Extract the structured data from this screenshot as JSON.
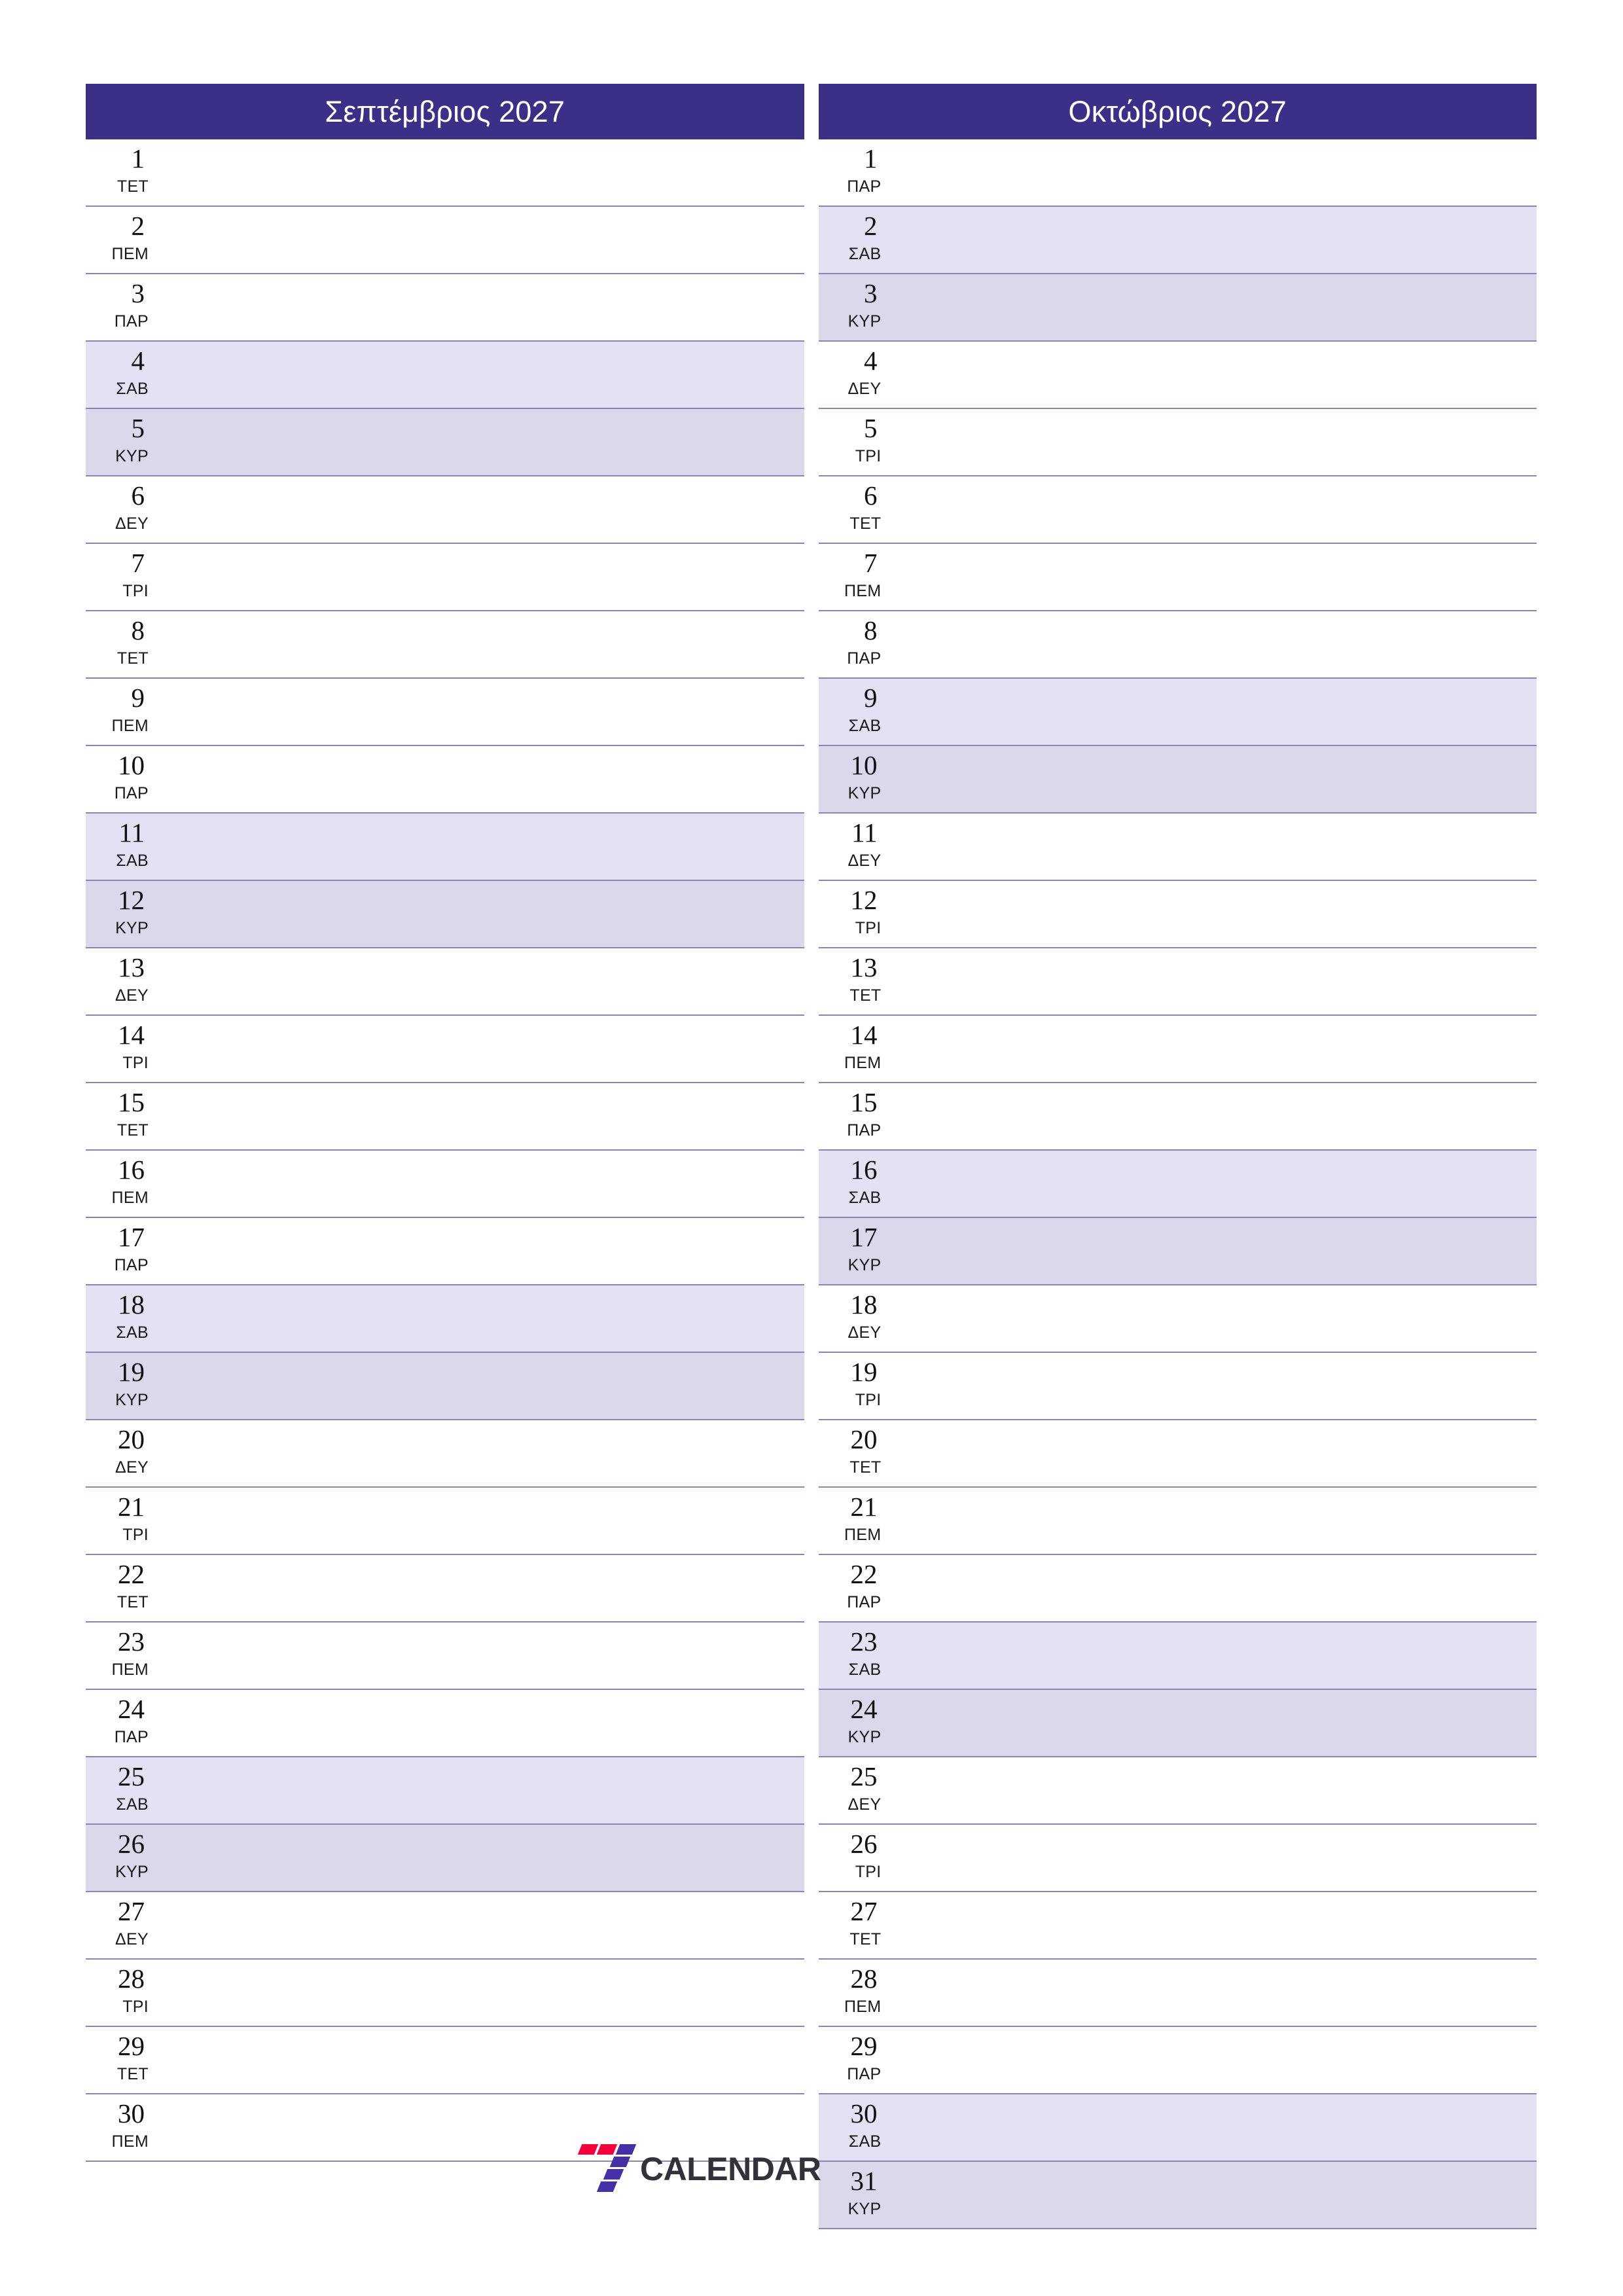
{
  "document": {
    "type": "two-month-planner",
    "orientation": "portrait",
    "colors": {
      "header_bg": "#3A3088",
      "header_text": "#FFFFFF",
      "saturday_bg": "#E2E2F4",
      "sunday_bg": "#DCD8EC",
      "row_divider": "#8A86B4",
      "logo_red": "#F4003C",
      "logo_purple": "#4530A8",
      "logo_word": "#32323A"
    }
  },
  "months": [
    {
      "title": "Σεπτέμβριος 2027",
      "days": [
        {
          "num": "1",
          "dow": "ΤΕΤ",
          "kind": "weekday"
        },
        {
          "num": "2",
          "dow": "ΠΕΜ",
          "kind": "weekday"
        },
        {
          "num": "3",
          "dow": "ΠΑΡ",
          "kind": "weekday"
        },
        {
          "num": "4",
          "dow": "ΣΑΒ",
          "kind": "sat"
        },
        {
          "num": "5",
          "dow": "ΚΥΡ",
          "kind": "sun"
        },
        {
          "num": "6",
          "dow": "ΔΕΥ",
          "kind": "weekday"
        },
        {
          "num": "7",
          "dow": "ΤΡΙ",
          "kind": "weekday"
        },
        {
          "num": "8",
          "dow": "ΤΕΤ",
          "kind": "weekday"
        },
        {
          "num": "9",
          "dow": "ΠΕΜ",
          "kind": "weekday"
        },
        {
          "num": "10",
          "dow": "ΠΑΡ",
          "kind": "weekday"
        },
        {
          "num": "11",
          "dow": "ΣΑΒ",
          "kind": "sat"
        },
        {
          "num": "12",
          "dow": "ΚΥΡ",
          "kind": "sun"
        },
        {
          "num": "13",
          "dow": "ΔΕΥ",
          "kind": "weekday"
        },
        {
          "num": "14",
          "dow": "ΤΡΙ",
          "kind": "weekday"
        },
        {
          "num": "15",
          "dow": "ΤΕΤ",
          "kind": "weekday"
        },
        {
          "num": "16",
          "dow": "ΠΕΜ",
          "kind": "weekday"
        },
        {
          "num": "17",
          "dow": "ΠΑΡ",
          "kind": "weekday"
        },
        {
          "num": "18",
          "dow": "ΣΑΒ",
          "kind": "sat"
        },
        {
          "num": "19",
          "dow": "ΚΥΡ",
          "kind": "sun"
        },
        {
          "num": "20",
          "dow": "ΔΕΥ",
          "kind": "weekday"
        },
        {
          "num": "21",
          "dow": "ΤΡΙ",
          "kind": "weekday"
        },
        {
          "num": "22",
          "dow": "ΤΕΤ",
          "kind": "weekday"
        },
        {
          "num": "23",
          "dow": "ΠΕΜ",
          "kind": "weekday"
        },
        {
          "num": "24",
          "dow": "ΠΑΡ",
          "kind": "weekday"
        },
        {
          "num": "25",
          "dow": "ΣΑΒ",
          "kind": "sat"
        },
        {
          "num": "26",
          "dow": "ΚΥΡ",
          "kind": "sun"
        },
        {
          "num": "27",
          "dow": "ΔΕΥ",
          "kind": "weekday"
        },
        {
          "num": "28",
          "dow": "ΤΡΙ",
          "kind": "weekday"
        },
        {
          "num": "29",
          "dow": "ΤΕΤ",
          "kind": "weekday"
        },
        {
          "num": "30",
          "dow": "ΠΕΜ",
          "kind": "weekday"
        }
      ]
    },
    {
      "title": "Οκτώβριος 2027",
      "days": [
        {
          "num": "1",
          "dow": "ΠΑΡ",
          "kind": "weekday"
        },
        {
          "num": "2",
          "dow": "ΣΑΒ",
          "kind": "sat"
        },
        {
          "num": "3",
          "dow": "ΚΥΡ",
          "kind": "sun"
        },
        {
          "num": "4",
          "dow": "ΔΕΥ",
          "kind": "weekday"
        },
        {
          "num": "5",
          "dow": "ΤΡΙ",
          "kind": "weekday"
        },
        {
          "num": "6",
          "dow": "ΤΕΤ",
          "kind": "weekday"
        },
        {
          "num": "7",
          "dow": "ΠΕΜ",
          "kind": "weekday"
        },
        {
          "num": "8",
          "dow": "ΠΑΡ",
          "kind": "weekday"
        },
        {
          "num": "9",
          "dow": "ΣΑΒ",
          "kind": "sat"
        },
        {
          "num": "10",
          "dow": "ΚΥΡ",
          "kind": "sun"
        },
        {
          "num": "11",
          "dow": "ΔΕΥ",
          "kind": "weekday"
        },
        {
          "num": "12",
          "dow": "ΤΡΙ",
          "kind": "weekday"
        },
        {
          "num": "13",
          "dow": "ΤΕΤ",
          "kind": "weekday"
        },
        {
          "num": "14",
          "dow": "ΠΕΜ",
          "kind": "weekday"
        },
        {
          "num": "15",
          "dow": "ΠΑΡ",
          "kind": "weekday"
        },
        {
          "num": "16",
          "dow": "ΣΑΒ",
          "kind": "sat"
        },
        {
          "num": "17",
          "dow": "ΚΥΡ",
          "kind": "sun"
        },
        {
          "num": "18",
          "dow": "ΔΕΥ",
          "kind": "weekday"
        },
        {
          "num": "19",
          "dow": "ΤΡΙ",
          "kind": "weekday"
        },
        {
          "num": "20",
          "dow": "ΤΕΤ",
          "kind": "weekday"
        },
        {
          "num": "21",
          "dow": "ΠΕΜ",
          "kind": "weekday"
        },
        {
          "num": "22",
          "dow": "ΠΑΡ",
          "kind": "weekday"
        },
        {
          "num": "23",
          "dow": "ΣΑΒ",
          "kind": "sat"
        },
        {
          "num": "24",
          "dow": "ΚΥΡ",
          "kind": "sun"
        },
        {
          "num": "25",
          "dow": "ΔΕΥ",
          "kind": "weekday"
        },
        {
          "num": "26",
          "dow": "ΤΡΙ",
          "kind": "weekday"
        },
        {
          "num": "27",
          "dow": "ΤΕΤ",
          "kind": "weekday"
        },
        {
          "num": "28",
          "dow": "ΠΕΜ",
          "kind": "weekday"
        },
        {
          "num": "29",
          "dow": "ΠΑΡ",
          "kind": "weekday"
        },
        {
          "num": "30",
          "dow": "ΣΑΒ",
          "kind": "sat"
        },
        {
          "num": "31",
          "dow": "ΚΥΡ",
          "kind": "sun"
        }
      ]
    }
  ],
  "footer": {
    "logo_mark": "seven-logo-icon",
    "logo_word": "CALENDAR"
  }
}
